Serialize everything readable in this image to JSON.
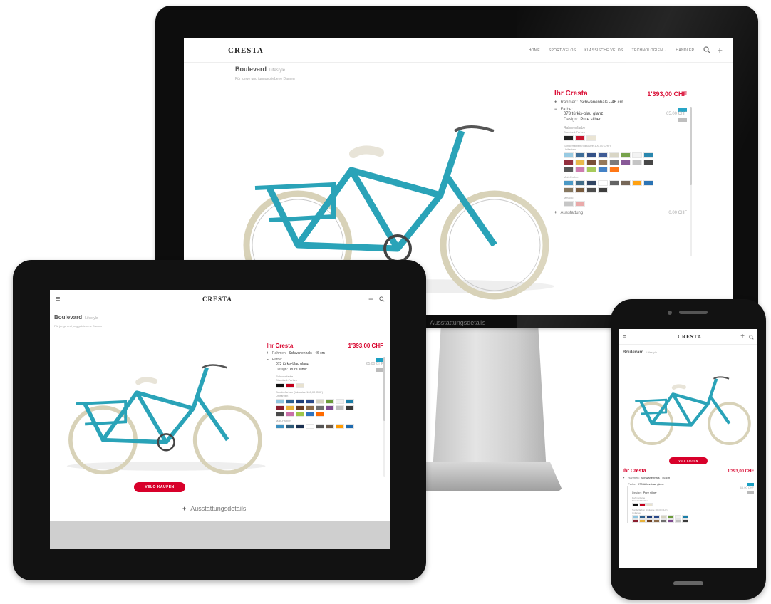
{
  "brand": {
    "logo": "CRESTA"
  },
  "nav": {
    "links": [
      "HOME",
      "SPORT-VELOS",
      "KLASSISCHE VELOS",
      "TECHNOLOGIEN ⌄",
      "HÄNDLER"
    ],
    "search_icon": "search-icon",
    "plus_icon": "plus-icon",
    "menu_icon": "hamburger-icon"
  },
  "product": {
    "title": "Boulevard",
    "category": "Lifestyle",
    "subtitle": "Für junge und junggebliebene Damen",
    "colors": {
      "frame": "#2aa3b8",
      "accent": "#d8002a"
    }
  },
  "configurator": {
    "heading": "Ihr Cresta",
    "price": "1'393,00 CHF",
    "frame_label": "Rahmen:",
    "frame_value": "Schwanenhals - 46 cm",
    "color_label": "Farbe:",
    "color_value": "073 türkis-blau glanz",
    "color_price": "65,00 CHF",
    "design_label": "Design:",
    "design_value": "Pure silber",
    "section_main": "Rahmenfarbe",
    "section_standard": "Standard-Farben",
    "section_special": "Sonderfarben (inklusive 100,00 CHF)",
    "section_uni": "Unifarben",
    "section_matt": "Matt-Farben",
    "section_metallic": "Metallic",
    "extra_label": "Ausstattung",
    "extra_price": "0,00 CHF"
  },
  "swatches": {
    "standard": [
      "#111111",
      "#c3001b",
      "#e8e2d0"
    ],
    "uni_row1": [
      "#8fc6e0",
      "#2b5f8e",
      "#1f3f7a",
      "#2a4a8a",
      "#d5d2c0",
      "#6a9a3a",
      "#f2f2f2",
      "#1a7ea8"
    ],
    "uni_row2": [
      "#8a1d2e",
      "#e8b23a",
      "#6b3d22",
      "#8a6a48",
      "#6e6e6e",
      "#7d4a8e",
      "#c0c0c0",
      "#3a3a3a"
    ],
    "uni_row3": [
      "#4a4a4a",
      "#c96fa8",
      "#9ec54a",
      "#2f74c0",
      "#ff6a00"
    ],
    "matt_row1": [
      "#3a8fc0",
      "#2e5c7a",
      "#1a3050",
      "#ffffff",
      "#555555",
      "#6a5a4a",
      "#ff9a00",
      "#1e6bb0"
    ],
    "matt_row2": [
      "#7a6a50",
      "#6a4a2a",
      "#3a3a3a",
      "#2a2a2a"
    ],
    "metallic": [
      "#c0c0c0",
      "#e8a0a0"
    ]
  },
  "cta": {
    "button": "VELO KAUFEN",
    "details": "Ausstattungsdetails"
  }
}
